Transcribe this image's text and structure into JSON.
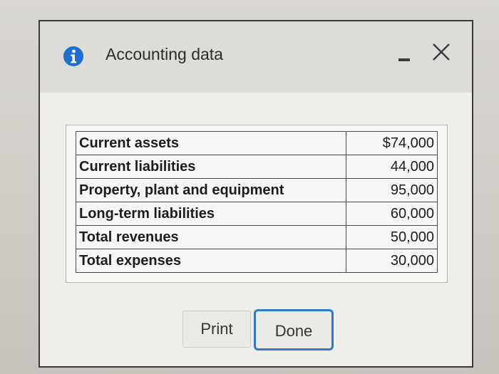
{
  "dialog": {
    "title": "Accounting data",
    "icons": {
      "info": "info-icon",
      "minimize": "minimize-icon",
      "close": "close-icon"
    },
    "accent_color": "#1f6fd0"
  },
  "table": {
    "rows": [
      {
        "label": "Current assets",
        "value": "$74,000"
      },
      {
        "label": "Current liabilities",
        "value": "44,000"
      },
      {
        "label": "Property, plant and equipment",
        "value": "95,000"
      },
      {
        "label": "Long-term liabilities",
        "value": "60,000"
      },
      {
        "label": "Total revenues",
        "value": "50,000"
      },
      {
        "label": "Total expenses",
        "value": "30,000"
      }
    ]
  },
  "buttons": {
    "print_label": "Print",
    "done_label": "Done"
  }
}
